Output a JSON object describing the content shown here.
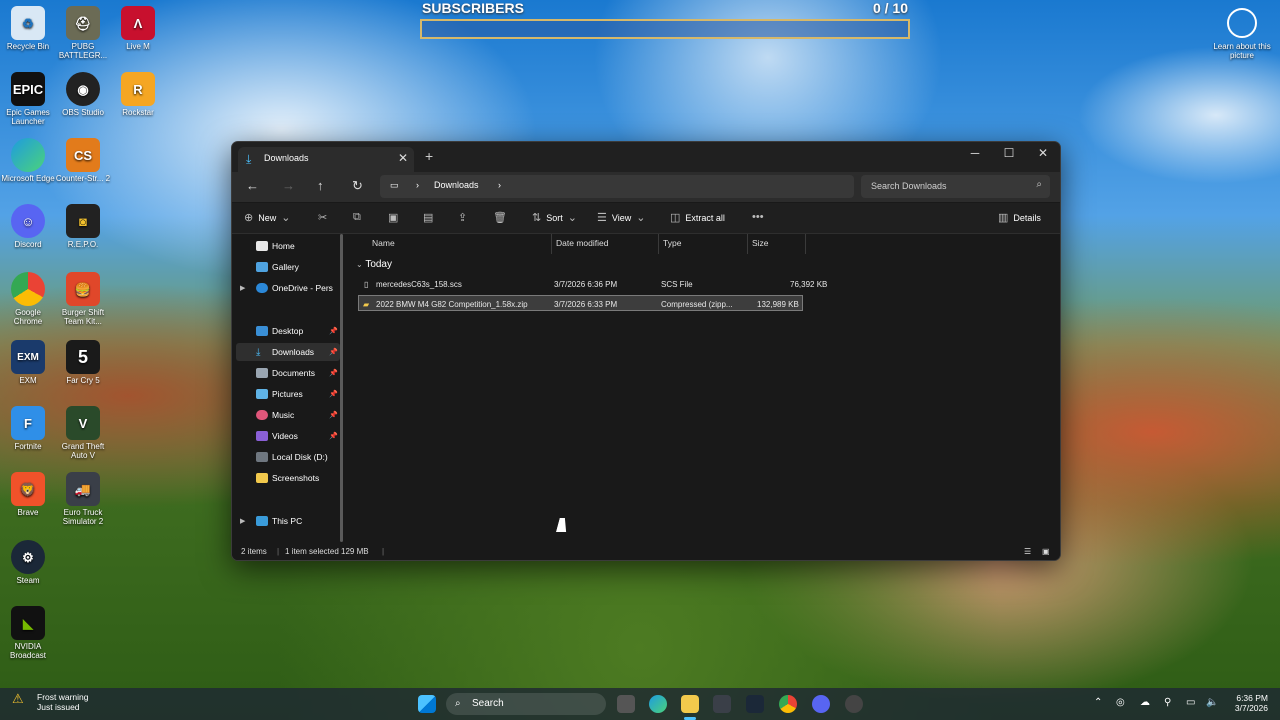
{
  "desktop": {
    "icons_col1": [
      "Recycle Bin",
      "Epic Games Launcher",
      "Microsoft Edge",
      "Discord",
      "Google Chrome",
      "EXM",
      "Fortnite",
      "Brave",
      "Steam",
      "NVIDIA Broadcast"
    ],
    "icons_col2": [
      "PUBG BATTLEGR...",
      "OBS Studio",
      "Counter-Str... 2",
      "R.E.P.O.",
      "Burger Shift Team Kit...",
      "Far Cry 5",
      "Grand Theft Auto V",
      "Euro Truck Simulator 2"
    ],
    "icons_col3": [
      "Live M",
      "Rockstar"
    ],
    "learn_more": "Learn about this picture"
  },
  "subscribers": {
    "title": "SUBSCRIBERS",
    "count": "0 / 10",
    "progress": 0
  },
  "explorer": {
    "tab_title": "Downloads",
    "breadcrumb": "Downloads",
    "search_placeholder": "Search Downloads",
    "commands": {
      "new": "New",
      "sort": "Sort",
      "view": "View",
      "extract": "Extract all",
      "details": "Details"
    },
    "sidebar": [
      {
        "label": "Home"
      },
      {
        "label": "Gallery"
      },
      {
        "label": "OneDrive - Pers"
      },
      {
        "label": "Desktop"
      },
      {
        "label": "Downloads"
      },
      {
        "label": "Documents"
      },
      {
        "label": "Pictures"
      },
      {
        "label": "Music"
      },
      {
        "label": "Videos"
      },
      {
        "label": "Local Disk (D:)"
      },
      {
        "label": "Screenshots"
      },
      {
        "label": "This PC"
      }
    ],
    "columns": {
      "name": "Name",
      "date": "Date modified",
      "type": "Type",
      "size": "Size"
    },
    "group": "Today",
    "files": [
      {
        "name": "mercedesC63s_158.scs",
        "date": "3/7/2026 6:36 PM",
        "type": "SCS File",
        "size": "76,392 KB"
      },
      {
        "name": "2022 BMW M4 G82 Competition_1.58x.zip",
        "date": "3/7/2026 6:33 PM",
        "type": "Compressed (zipp...",
        "size": "132,989 KB"
      }
    ],
    "status": {
      "items": "2 items",
      "selected": "1 item selected  129 MB"
    }
  },
  "taskbar": {
    "weather_title": "Frost warning",
    "weather_sub": "Just issued",
    "search": "Search",
    "time": "6:36 PM",
    "date": "3/7/2026"
  }
}
